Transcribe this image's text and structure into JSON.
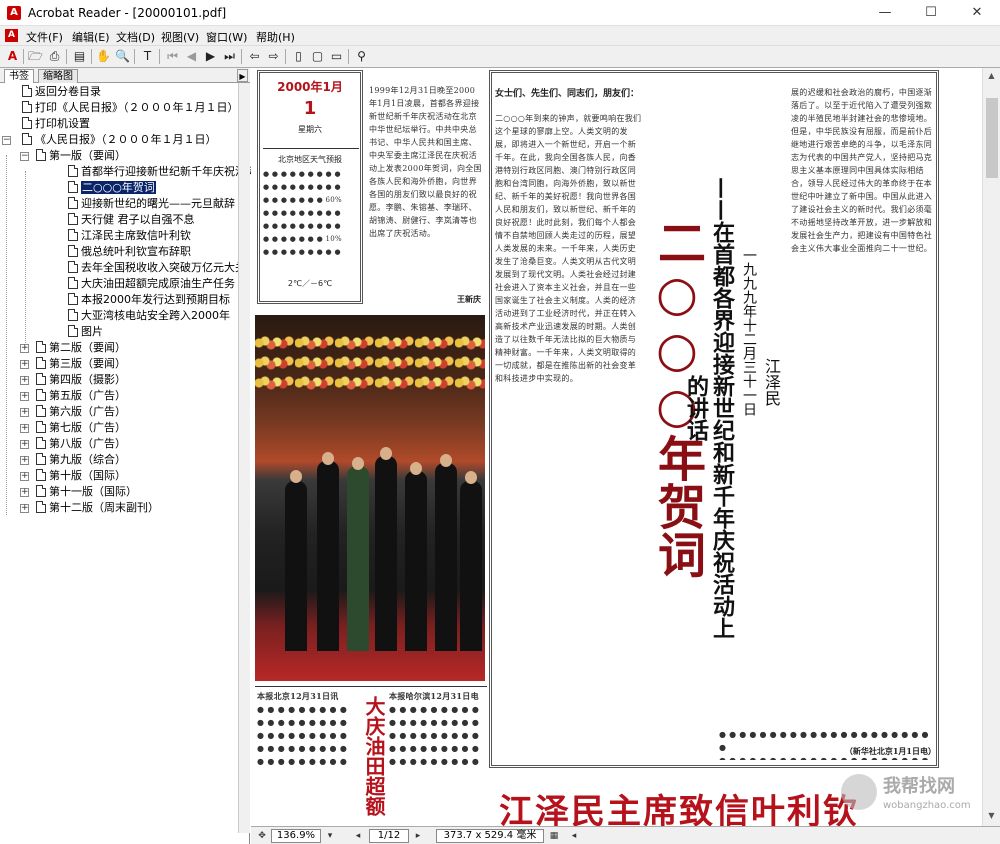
{
  "window": {
    "title": "Acrobat Reader - [20000101.pdf]",
    "minimize": "—",
    "maximize": "☐",
    "close": "✕"
  },
  "menu": [
    "文件(F)",
    "编辑(E)",
    "文档(D)",
    "视图(V)",
    "窗口(W)",
    "帮助(H)"
  ],
  "tabs": {
    "bookmarks": "书签",
    "thumbnails": "缩略图"
  },
  "bookmarks": [
    {
      "label": "返回分卷目录",
      "level": 0
    },
    {
      "label": "打印《人民日报》（２０００年１月１日）",
      "level": 0
    },
    {
      "label": "打印机设置",
      "level": 0
    },
    {
      "label": "《人民日报》（２０００年１月１日）",
      "level": 0,
      "expanded": true
    },
    {
      "label": "第一版（要闻）",
      "level": 1,
      "expanded": true
    },
    {
      "label": "首都举行迎接新世纪新千年庆祝活动",
      "level": 2
    },
    {
      "label": "二○○○年贺词",
      "level": 2,
      "selected": true
    },
    {
      "label": "迎接新世纪的曙光——元旦献辞",
      "level": 2
    },
    {
      "label": "天行健 君子以自强不息",
      "level": 2
    },
    {
      "label": "江泽民主席致信叶利钦",
      "level": 2
    },
    {
      "label": "俄总统叶利钦宣布辞职",
      "level": 2
    },
    {
      "label": "去年全国税收收入突破万亿元大关",
      "level": 2
    },
    {
      "label": "大庆油田超额完成原油生产任务",
      "level": 2
    },
    {
      "label": "本报2000年发行达到预期目标",
      "level": 2
    },
    {
      "label": "大亚湾核电站安全跨入2000年",
      "level": 2
    },
    {
      "label": "图片",
      "level": 2
    },
    {
      "label": "第二版（要闻）",
      "level": 1
    },
    {
      "label": "第三版（要闻）",
      "level": 1
    },
    {
      "label": "第四版（摄影）",
      "level": 1
    },
    {
      "label": "第五版（广告）",
      "level": 1
    },
    {
      "label": "第六版（广告）",
      "level": 1
    },
    {
      "label": "第七版（广告）",
      "level": 1
    },
    {
      "label": "第八版（广告）",
      "level": 1
    },
    {
      "label": "第九版（综合）",
      "level": 1
    },
    {
      "label": "第十版（国际）",
      "level": 1
    },
    {
      "label": "第十一版（国际）",
      "level": 1
    },
    {
      "label": "第十二版（周末副刊）",
      "level": 1
    }
  ],
  "status": {
    "zoom": "136.9%",
    "page": "1/12",
    "size": "373.7 x 529.4 毫米"
  },
  "paper": {
    "date": "2000年1月",
    "day": "1",
    "weekday": "星期六",
    "weather_title": "北京地区天气预报",
    "weather_p1": "60%",
    "weather_p2": "10%",
    "temp": "2℃／－6℃",
    "col2_text": "1999年12月31日晚至2000年1月1日凌晨，首都各界迎接新世纪新千年庆祝活动在北京中华世纪坛举行。中共中央总书记、中华人民共和国主席、中央军委主席江泽民在庆祝活动上发表2000年贺词，向全国各族人民和海外侨胞，向世界各国的朋友们致以最良好的祝愿。李鹏、朱镕基、李瑞环、胡锦涛、尉健行、李岚清等也出席了庆祝活动。",
    "col2_byline": "王新庆",
    "greeting": "女士们、先生们、同志们，朋友们：",
    "main_text": "二○○○年到来的钟声，就要鸣响在我们这个星球的寥廓上空。人类文明的发展，即将进入一个新世纪，开启一个新千年。在此，我向全国各族人民，向香港特别行政区同胞、澳门特别行政区同胞和台湾同胞，向海外侨胞，致以新世纪、新千年的美好祝愿！我向世界各国人民和朋友们，致以新世纪、新千年的良好祝愿！此时此刻，我们每个人都会情不自禁地回顾人类走过的历程，展望人类发展的未来。一千年来，人类历史发生了沧桑巨变。人类文明从古代文明发展到了现代文明。人类社会经过封建社会进入了资本主义社会，并且在一些国家诞生了社会主义制度。人类的经济活动进到了工业经济时代，并正在转入高新技术产业迅速发展的时期。人类创造了以往数千年无法比拟的巨大物质与精神财富。一千年来，人类文明取得的一切成就，都是在推陈出新的社会变革和科技进步中实现的。",
    "right_text": "展的迟缓和社会政治的腐朽，中国逐渐落后了。以至于近代陷入了遭受列强欺凌的半殖民地半封建社会的悲惨境地。但是，中华民族没有屈服，而是前仆后继地进行艰苦卓绝的斗争，以毛泽东同志为代表的中国共产党人，坚持把马克思主义基本原理同中国具体实际相结合，领导人民经过伟大的革命终于在本世纪中叶建立了新中国。中国从此进入了建设社会主义的新时代。我们必须毫不动摇地坚持改革开放，进一步解放和发展社会生产力，把建设有中国特色社会主义伟大事业全面推向二十一世纪。",
    "title_chars": "二○○○年贺词",
    "subtitle": "——在首都各界迎接新世纪和新千年庆祝活动上的讲话",
    "date_line": "一九九九年十二月三十一日",
    "author": "江泽民",
    "xinhua": "（新华社北京1月1日电）",
    "bottom_story1_head": "本报北京12月31日讯",
    "bottom_story2_head": "本报哈尔滨12月31日电",
    "daqing_headline": "大庆油田超额",
    "bottom_headline": "江泽民主席致信叶利钦"
  },
  "watermark": {
    "text": "我帮找网",
    "url": "wobangzhao.com"
  },
  "colors": {
    "headline_red": "#b5121b",
    "title_dark_red": "#8a0f14",
    "selection": "#0a246a"
  }
}
